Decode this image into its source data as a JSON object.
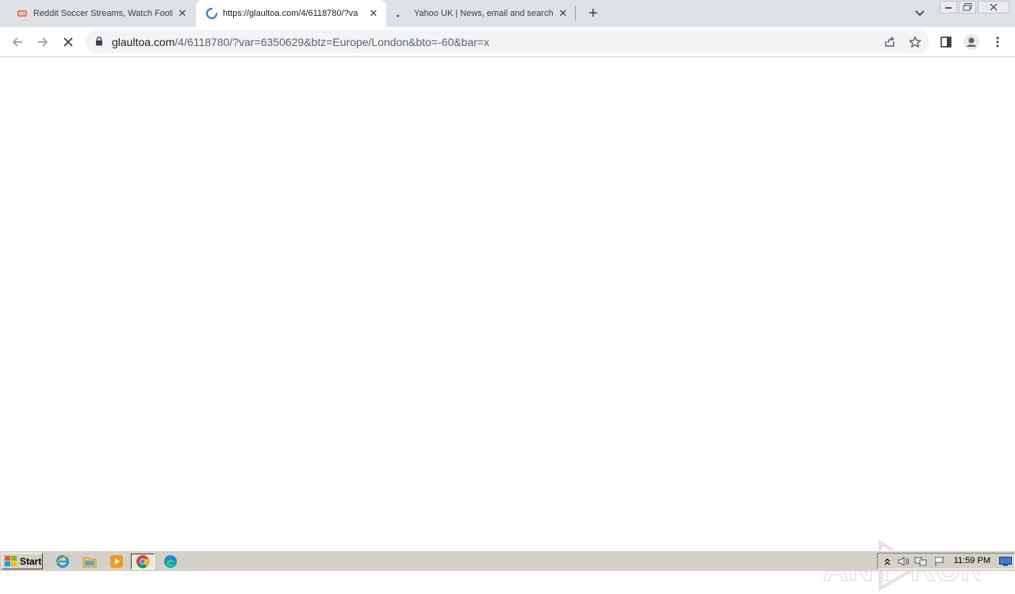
{
  "tabs": [
    {
      "title": "Reddit Soccer Streams, Watch Footb",
      "favicon": "reddit-favicon-icon"
    },
    {
      "title": "https://glaultoa.com/4/6118780/?va",
      "favicon": "loading-spinner-icon",
      "active": true
    },
    {
      "title": "Yahoo UK | News, email and search",
      "favicon": "loading-dot-icon"
    }
  ],
  "new_tab_label": "+",
  "address_bar": {
    "host": "glaultoa.com",
    "path": "/4/6118780/?var=6350629&btz=Europe/London&bto=-60&bar=x"
  },
  "watermark": {
    "text_left": "ANY",
    "text_right": "RUN"
  },
  "taskbar": {
    "start_label": "Start",
    "clock": "11:59 PM"
  },
  "colors": {
    "tabstrip": "#dee1e6",
    "omnibox": "#f1f3f4",
    "spinner": "#1a73e8",
    "taskbar": "#d4d0c8"
  }
}
